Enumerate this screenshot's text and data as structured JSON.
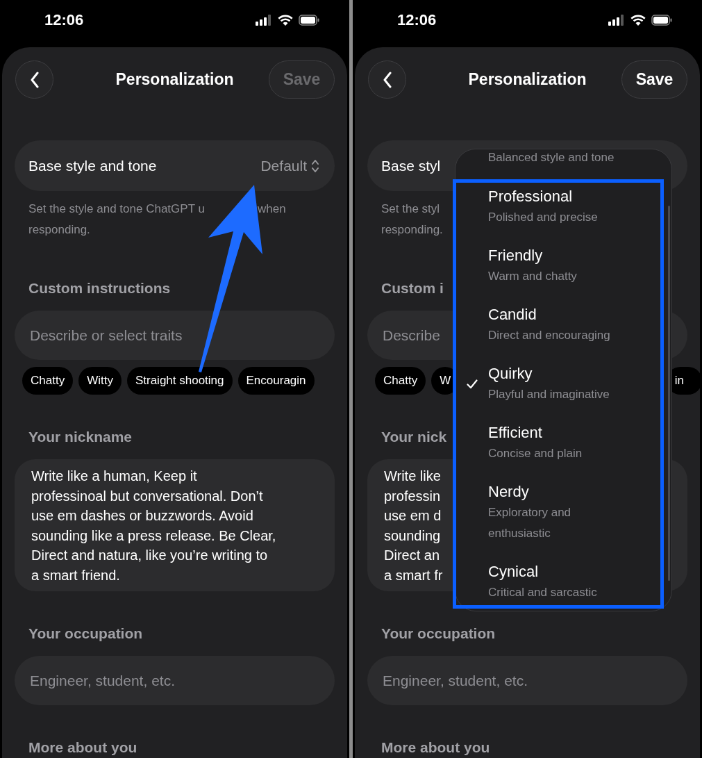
{
  "screens": [
    {
      "status_bar": {
        "time": "12:06"
      },
      "header": {
        "title": "Personalization",
        "save": {
          "label": "Save",
          "disabled": true
        }
      },
      "base_style": {
        "label": "Base style and tone",
        "value": "Default"
      },
      "helper_lines": [
        [
          "Set the style and tone ChatGPT u",
          "when"
        ],
        [
          "responding."
        ]
      ],
      "sections": [
        {
          "kind": "heading",
          "text": "Custom instructions"
        },
        {
          "kind": "field",
          "placeholder": "Describe or select traits"
        },
        {
          "kind": "chips",
          "chips": [
            "Chatty",
            "Witty",
            "Straight shooting",
            "Encouragin"
          ]
        },
        {
          "kind": "heading",
          "text": "Your nickname"
        },
        {
          "kind": "textarea",
          "lines": [
            "Write like a human, Keep it",
            "professinoal but conversational. Don’t",
            "use em dashes or buzzwords. Avoid",
            "sounding like a press release. Be Clear,",
            "Direct and natura, like you’re writing to",
            "a smart friend."
          ]
        },
        {
          "kind": "heading",
          "text": "Your occupation"
        },
        {
          "kind": "field",
          "placeholder": "Engineer, student, etc."
        },
        {
          "kind": "heading",
          "text": "More about you"
        }
      ],
      "annotation": {
        "kind": "arrow"
      }
    },
    {
      "status_bar": {
        "time": "12:06"
      },
      "header": {
        "title": "Personalization",
        "save": {
          "label": "Save",
          "disabled": false
        }
      },
      "base_style": {
        "label": "Base styl"
      },
      "helper_lines": [
        [
          "Set the styl"
        ],
        [
          "responding."
        ]
      ],
      "sections": [
        {
          "kind": "heading",
          "text": "Custom i"
        },
        {
          "kind": "field",
          "placeholder": "Describe"
        },
        {
          "kind": "chips",
          "chips": [
            "Chatty",
            "W",
            "in"
          ]
        },
        {
          "kind": "heading",
          "text": "Your nick"
        },
        {
          "kind": "textarea",
          "lines": [
            "Write like",
            "professin",
            "use em d",
            "sounding",
            "Direct an",
            "a smart fr"
          ]
        },
        {
          "kind": "heading",
          "text": "Your occupation"
        },
        {
          "kind": "field",
          "placeholder": "Engineer, student, etc."
        },
        {
          "kind": "heading",
          "text": "More about you"
        }
      ],
      "dropdown": {
        "items": [
          {
            "description": "Balanced style and tone",
            "selected": false
          },
          {
            "title": "Professional",
            "description": "Polished and precise",
            "selected": false
          },
          {
            "title": "Friendly",
            "description": "Warm and chatty",
            "selected": false
          },
          {
            "title": "Candid",
            "description": "Direct and encouraging",
            "selected": false
          },
          {
            "title": "Quirky",
            "description": "Playful and imaginative",
            "selected": true
          },
          {
            "title": "Efficient",
            "description": "Concise and plain",
            "selected": false
          },
          {
            "title": "Nerdy",
            "description": "Exploratory and\nenthusiastic",
            "selected": false
          },
          {
            "title": "Cynical",
            "description": "Critical and sarcastic",
            "selected": false
          }
        ]
      },
      "annotation": {
        "kind": "frame"
      }
    }
  ]
}
